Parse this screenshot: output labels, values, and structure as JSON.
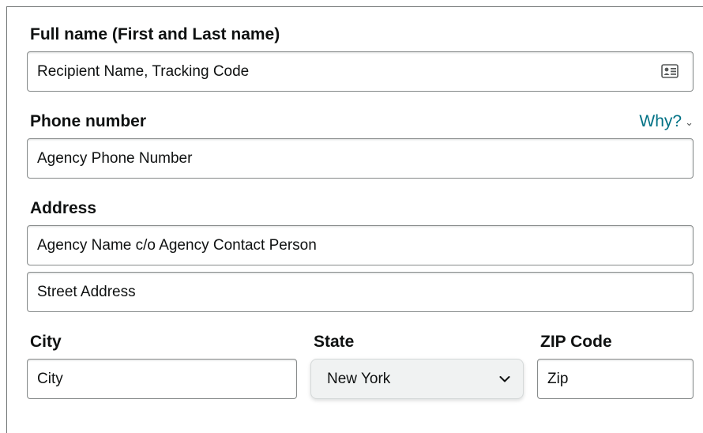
{
  "full_name": {
    "label": "Full name (First and Last name)",
    "value": "Recipient Name, Tracking Code",
    "icon": "contact-card-icon"
  },
  "phone": {
    "label": "Phone number",
    "value": "Agency Phone Number",
    "why_link": "Why?"
  },
  "address": {
    "label": "Address",
    "line1": "Agency Name c/o Agency Contact Person",
    "line2": "Street Address"
  },
  "city": {
    "label": "City",
    "value": "City"
  },
  "state": {
    "label": "State",
    "selected": "New York"
  },
  "zip": {
    "label": "ZIP Code",
    "value": "Zip"
  },
  "colors": {
    "link": "#007185",
    "text": "#0f1111",
    "border": "#888c8c",
    "select_bg": "#f0f2f2"
  }
}
